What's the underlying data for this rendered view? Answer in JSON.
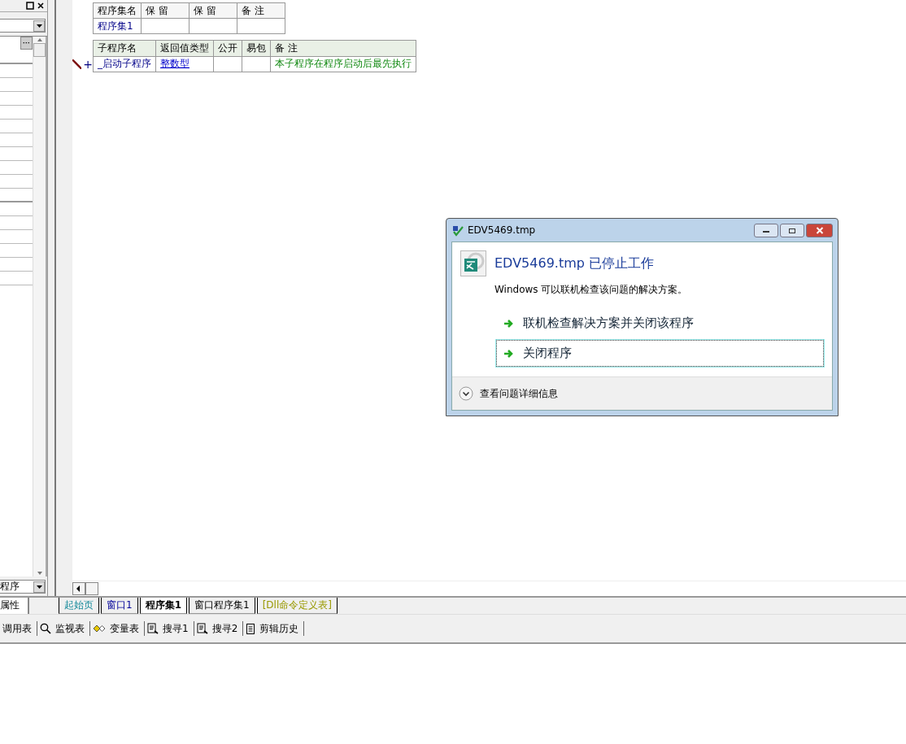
{
  "left_panel": {
    "more_button": "···",
    "bottom_dropdown": "程序",
    "tab": "属性"
  },
  "assembly_table": {
    "columns": [
      "程序集名",
      "保 留",
      "保 留",
      "备 注"
    ],
    "rows": [
      [
        "程序集1",
        "",
        "",
        ""
      ]
    ]
  },
  "sub_table": {
    "columns": [
      "子程序名",
      "返回值类型",
      "公开",
      "易包",
      "备 注"
    ],
    "rows": [
      {
        "marker": "+",
        "cells": [
          "_启动子程序",
          "整数型",
          "",
          "",
          "本子程序在程序启动后最先执行"
        ]
      }
    ]
  },
  "editor_tabs": [
    {
      "label": "起始页",
      "kind": "start",
      "selected": false
    },
    {
      "label": "窗口1",
      "kind": "window",
      "selected": false
    },
    {
      "label": "程序集1",
      "kind": "code",
      "selected": true
    },
    {
      "label": "窗口程序集1",
      "kind": "code",
      "selected": false
    },
    {
      "label": "[Dll命令定义表]",
      "kind": "dll",
      "selected": false
    }
  ],
  "toolbar": [
    {
      "label": "调用表",
      "kind": "plain"
    },
    {
      "label": "监视表",
      "kind": "watch"
    },
    {
      "label": "变量表",
      "kind": "variables"
    },
    {
      "label": "搜寻1",
      "kind": "find"
    },
    {
      "label": "搜寻2",
      "kind": "find"
    },
    {
      "label": "剪辑历史",
      "kind": "history"
    }
  ],
  "dialog": {
    "title": "EDV5469.tmp",
    "heading": "EDV5469.tmp 已停止工作",
    "message": "Windows 可以联机检查该问题的解决方案。",
    "options": [
      {
        "label": "联机检查解决方案并关闭该程序",
        "selected": false
      },
      {
        "label": "关闭程序",
        "selected": true
      }
    ],
    "details": {
      "label": "查看问题详细信息",
      "expanded": false
    }
  }
}
